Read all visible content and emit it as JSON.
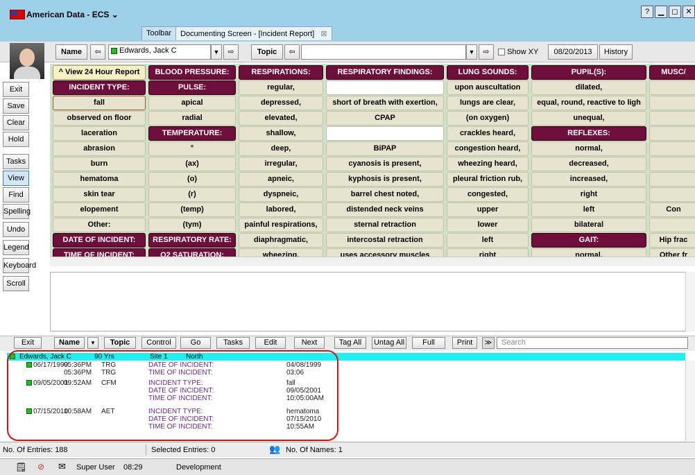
{
  "window": {
    "title": "American Data - ECS",
    "tabs": [
      "Toolbar",
      "Documenting Screen - [Incident Report]"
    ],
    "close_tab": "⊠",
    "controls": [
      "?",
      "▁",
      "◻",
      "✕"
    ]
  },
  "topbar": {
    "name_label": "Name",
    "patient_name": "Edwards, Jack C",
    "topic_label": "Topic",
    "topic_value": "",
    "show_xy_label": "Show XY",
    "date": "08/20/2013",
    "history_label": "History"
  },
  "sidebar": [
    "Exit",
    "Save",
    "Clear",
    "Hold",
    "Tasks",
    "View",
    "Find",
    "Spelling",
    "Undo",
    "Legend",
    "Keyboard",
    "Scroll"
  ],
  "grid": {
    "columns": [
      {
        "cells": [
          {
            "t": "^ View 24 Hour Report",
            "k": "hdr2"
          },
          {
            "t": "INCIDENT TYPE:",
            "k": "hdr"
          },
          {
            "t": "fall",
            "k": "sel"
          },
          {
            "t": "observed on floor"
          },
          {
            "t": "laceration"
          },
          {
            "t": "abrasion"
          },
          {
            "t": "burn"
          },
          {
            "t": "hematoma"
          },
          {
            "t": "skin tear"
          },
          {
            "t": "elopement"
          },
          {
            "t": "Other:"
          },
          {
            "t": "DATE OF INCIDENT:",
            "k": "hdr"
          },
          {
            "t": "TIME OF INCIDENT:",
            "k": "hdr"
          }
        ]
      },
      {
        "cells": [
          {
            "t": "BLOOD PRESSURE:",
            "k": "hdr"
          },
          {
            "t": "PULSE:",
            "k": "hdr"
          },
          {
            "t": "apical"
          },
          {
            "t": "radial"
          },
          {
            "t": "TEMPERATURE:",
            "k": "hdr"
          },
          {
            "t": "°"
          },
          {
            "t": "(ax)"
          },
          {
            "t": "(o)"
          },
          {
            "t": "(r)"
          },
          {
            "t": "(temp)"
          },
          {
            "t": "(tym)"
          },
          {
            "t": "RESPIRATORY RATE:",
            "k": "hdr"
          },
          {
            "t": "O2 SATURATION:",
            "k": "hdr"
          }
        ]
      },
      {
        "cells": [
          {
            "t": "RESPIRATIONS:",
            "k": "hdr"
          },
          {
            "t": "regular,"
          },
          {
            "t": "depressed,"
          },
          {
            "t": "elevated,"
          },
          {
            "t": "shallow,"
          },
          {
            "t": "deep,"
          },
          {
            "t": "irregular,"
          },
          {
            "t": "apneic,"
          },
          {
            "t": "dyspneic,"
          },
          {
            "t": "labored,"
          },
          {
            "t": "painful respirations,"
          },
          {
            "t": "diaphragmatic,"
          },
          {
            "t": "wheezing,"
          }
        ]
      },
      {
        "cells": [
          {
            "t": "RESPIRATORY FINDINGS:",
            "k": "hdr"
          },
          {
            "t": "",
            "k": "blank"
          },
          {
            "t": "short of breath with exertion,"
          },
          {
            "t": "CPAP"
          },
          {
            "t": "",
            "k": "blank"
          },
          {
            "t": "BiPAP"
          },
          {
            "t": "cyanosis is present,"
          },
          {
            "t": "kyphosis is present,"
          },
          {
            "t": "barrel chest noted,"
          },
          {
            "t": "distended neck veins"
          },
          {
            "t": "sternal retraction"
          },
          {
            "t": "intercostal retraction"
          },
          {
            "t": "uses accessory muscles"
          }
        ]
      },
      {
        "cells": [
          {
            "t": "LUNG SOUNDS:",
            "k": "hdr"
          },
          {
            "t": "upon auscultation"
          },
          {
            "t": "lungs are clear,"
          },
          {
            "t": "(on oxygen)"
          },
          {
            "t": "crackles heard,"
          },
          {
            "t": "congestion heard,"
          },
          {
            "t": "wheezing heard,"
          },
          {
            "t": "pleural friction rub,"
          },
          {
            "t": "congested,"
          },
          {
            "t": "upper"
          },
          {
            "t": "lower"
          },
          {
            "t": "left"
          },
          {
            "t": "right"
          }
        ]
      },
      {
        "cells": [
          {
            "t": "PUPIL(S):",
            "k": "hdr"
          },
          {
            "t": "dilated,"
          },
          {
            "t": "equal, round, reactive to ligh"
          },
          {
            "t": "unequal,"
          },
          {
            "t": "REFLEXES:",
            "k": "hdr"
          },
          {
            "t": "normal,"
          },
          {
            "t": "decreased,"
          },
          {
            "t": "increased,"
          },
          {
            "t": "right"
          },
          {
            "t": "left"
          },
          {
            "t": "bilateral"
          },
          {
            "t": "GAIT:",
            "k": "hdr"
          },
          {
            "t": "normal,"
          }
        ]
      },
      {
        "cells": [
          {
            "t": "MUSC/",
            "k": "hdr"
          },
          {
            "t": ""
          },
          {
            "t": ""
          },
          {
            "t": ""
          },
          {
            "t": ""
          },
          {
            "t": ""
          },
          {
            "t": ""
          },
          {
            "t": ""
          },
          {
            "t": ""
          },
          {
            "t": "Con"
          },
          {
            "t": ""
          },
          {
            "t": "Hip frac"
          },
          {
            "t": "Other fr"
          }
        ]
      }
    ]
  },
  "bottombar": {
    "buttons": [
      "Exit",
      "Name",
      "Topic",
      "Control",
      "Go",
      "Tasks",
      "Edit",
      "Next",
      "Tag All",
      "Untag All",
      "Full",
      "Print"
    ],
    "search_placeholder": "Search"
  },
  "list": {
    "patient": {
      "name": "Edwards, Jack C",
      "age": "90 Yrs",
      "site": "Site 1",
      "unit": "North"
    },
    "entries": [
      {
        "date": "06/17/1999",
        "time": "05:36PM",
        "user": "TRG",
        "fields": [
          {
            "label": "DATE OF INCIDENT:",
            "value": "04/08/1999"
          }
        ]
      },
      {
        "date": "",
        "time": "05:36PM",
        "user": "TRG",
        "fields": [
          {
            "label": "TIME OF INCIDENT:",
            "value": "03:06"
          }
        ]
      },
      {
        "date": "09/05/2001",
        "time": "09:52AM",
        "user": "CFM",
        "fields": [
          {
            "label": "INCIDENT TYPE:",
            "value": "fall"
          },
          {
            "label": "DATE OF INCIDENT:",
            "value": "09/05/2001"
          },
          {
            "label": "TIME OF INCIDENT:",
            "value": "10:05:00AM"
          }
        ]
      },
      {
        "date": "07/15/2010",
        "time": "10:58AM",
        "user": "AET",
        "fields": [
          {
            "label": "INCIDENT TYPE:",
            "value": "hematoma"
          },
          {
            "label": "DATE OF INCIDENT:",
            "value": "07/15/2010"
          },
          {
            "label": "TIME OF INCIDENT:",
            "value": "10:55AM"
          }
        ]
      }
    ]
  },
  "status": {
    "entries": "No. Of Entries: 188",
    "selected": "Selected Entries: 0",
    "names": "No. Of Names: 1"
  },
  "taskbar": {
    "user": "Super User",
    "time": "08:29",
    "env": "Development"
  },
  "colors": {
    "header": "#6e0f3b",
    "cell": "#e6e3ce",
    "list_head": "#1ff0f0",
    "highlight": "#d81010"
  }
}
